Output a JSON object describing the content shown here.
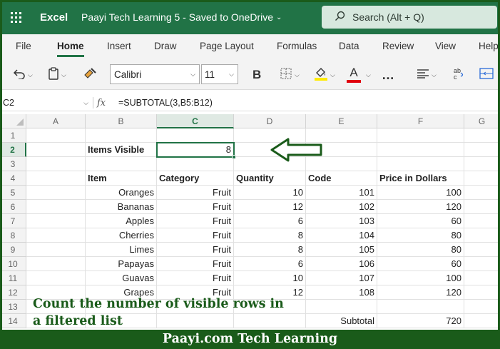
{
  "titlebar": {
    "app_name": "Excel",
    "doc_title": "Paayi Tech Learning 5  -  Saved to OneDrive",
    "search_placeholder": "Search (Alt + Q)"
  },
  "ribbon_tabs": [
    "File",
    "Home",
    "Insert",
    "Draw",
    "Page Layout",
    "Formulas",
    "Data",
    "Review",
    "View",
    "Help"
  ],
  "active_tab": "Home",
  "toolbar": {
    "font_name": "Calibri",
    "font_size": "11",
    "bold_label": "B",
    "font_color_label": "A",
    "more_label": "…",
    "highlight_color": "#ffeb00",
    "font_color": "#e0000c"
  },
  "formula_bar": {
    "cell_ref": "C2",
    "fx_label": "fx",
    "formula": "=SUBTOTAL(3,B5:B12)"
  },
  "grid": {
    "columns": [
      "A",
      "B",
      "C",
      "D",
      "E",
      "F",
      "G"
    ],
    "rows": [
      "1",
      "2",
      "3",
      "4",
      "5",
      "6",
      "7",
      "8",
      "9",
      "10",
      "11",
      "12",
      "13",
      "14"
    ],
    "items_visible_label": "Items Visible",
    "items_visible_value": "8",
    "headers": [
      "Item",
      "Category",
      "Quantity",
      "Code",
      "Price in Dollars"
    ],
    "data": [
      [
        "Oranges",
        "Fruit",
        "10",
        "101",
        "100"
      ],
      [
        "Bananas",
        "Fruit",
        "12",
        "102",
        "120"
      ],
      [
        "Apples",
        "Fruit",
        "6",
        "103",
        "60"
      ],
      [
        "Cherries",
        "Fruit",
        "8",
        "104",
        "80"
      ],
      [
        "Limes",
        "Fruit",
        "8",
        "105",
        "80"
      ],
      [
        "Papayas",
        "Fruit",
        "6",
        "106",
        "60"
      ],
      [
        "Guavas",
        "Fruit",
        "10",
        "107",
        "100"
      ],
      [
        "Grapes",
        "Fruit",
        "12",
        "108",
        "120"
      ]
    ],
    "subtotal_label": "Subtotal",
    "subtotal_value": "720"
  },
  "overlay": {
    "caption_line1": "Count the number of visible rows in",
    "caption_line2": "a filtered list",
    "footer": "Paayi.com Tech Learning"
  },
  "colors": {
    "excel_green": "#217346",
    "frame_green": "#1a5b1a"
  }
}
